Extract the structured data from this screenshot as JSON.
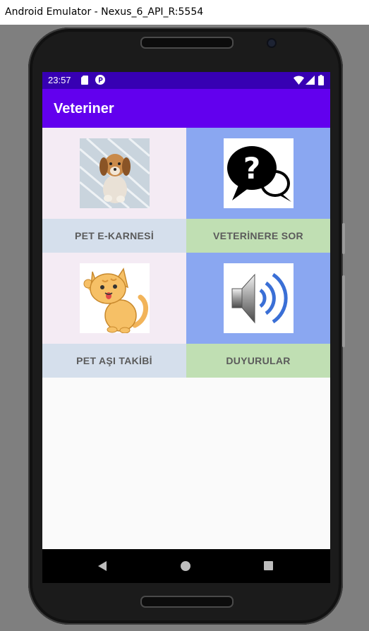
{
  "window": {
    "title": "Android Emulator - Nexus_6_API_R:5554"
  },
  "status_bar": {
    "time": "23:57",
    "icons": [
      "sim-card-icon",
      "p-notification-icon",
      "wifi-icon",
      "signal-icon",
      "battery-icon"
    ]
  },
  "app_bar": {
    "title": "Veteriner",
    "color": "#6200ee",
    "status_color": "#3700b3"
  },
  "tiles": [
    {
      "label": "PET E-KARNESİ",
      "image": "puppy-image",
      "image_bg": "#f4ebf4",
      "button_bg": "#d5dfec"
    },
    {
      "label": "VETERİNERE SOR",
      "image": "question-speech-bubbles-image",
      "image_bg": "#8aa7f1",
      "button_bg": "#c0dfb3"
    },
    {
      "label": "PET AŞI TAKİBİ",
      "image": "cat-image",
      "image_bg": "#f4ebf4",
      "button_bg": "#d5dfec"
    },
    {
      "label": "DUYURULAR",
      "image": "speaker-image",
      "image_bg": "#8aa7f1",
      "button_bg": "#c0dfb3"
    }
  ],
  "nav_bar": {
    "icons": [
      "back-icon",
      "home-icon",
      "recents-icon"
    ]
  }
}
